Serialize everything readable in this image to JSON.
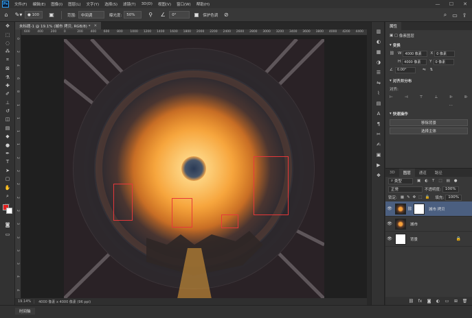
{
  "menubar": {
    "logo": "Ps",
    "items": [
      "文件(F)",
      "编辑(E)",
      "图像(I)",
      "图层(L)",
      "文字(Y)",
      "选择(S)",
      "滤镜(T)",
      "3D(D)",
      "视图(V)",
      "窗口(W)",
      "帮助(H)"
    ],
    "window_controls": [
      "—",
      "☐",
      "✕"
    ]
  },
  "options_bar": {
    "brush_size": "100",
    "range_label": "范围:",
    "range_value": "中间调",
    "exposure_label": "曝光度:",
    "exposure_value": "50%",
    "angle_value": "0°",
    "protect_tones_label": "保护色调"
  },
  "document": {
    "tab_title": "未标题-1 @ 19.1% (城市 拷贝, RGB/8) *",
    "zoom": "19.14%",
    "size_info": "4000 像素 x 4000 像素 (96 ppi)"
  },
  "ruler": {
    "h_labels": [
      "600",
      "400",
      "200",
      "0",
      "200",
      "400",
      "600",
      "800",
      "1000",
      "1200",
      "1400",
      "1600",
      "1800",
      "2000",
      "2200",
      "2400",
      "2600",
      "2800",
      "3000",
      "3200",
      "3400",
      "3600",
      "3800",
      "4000",
      "4200",
      "4400",
      "4600"
    ],
    "v_labels": [
      "0",
      "2",
      "4",
      "6",
      "8",
      "1",
      "1",
      "1",
      "1",
      "2",
      "2",
      "2",
      "2",
      "2",
      "3",
      "3",
      "3",
      "3",
      "4",
      "4"
    ]
  },
  "properties": {
    "tabs": [
      "属性"
    ],
    "layer_kind": "像素图层",
    "transform_label": "变换",
    "w_label": "W",
    "w_value": "4000 像素",
    "h_label": "H",
    "h_value": "4000 像素",
    "x_label": "X",
    "x_value": "0 像素",
    "y_label": "Y",
    "y_value": "0 像素",
    "angle_value": "0.00°",
    "align_label": "对齐并分布",
    "align_sub": "对齐:",
    "quick_actions_label": "快速操作",
    "remove_bg_button": "移除背景",
    "select_subject_button": "选择主体"
  },
  "layers_panel": {
    "tabs": [
      "3D",
      "图层",
      "通道",
      "路径"
    ],
    "filter_kind": "类型",
    "blend_mode": "正常",
    "opacity_label": "不透明度:",
    "opacity_value": "100%",
    "lock_label": "锁定:",
    "fill_label": "填充:",
    "fill_value": "100%",
    "layers": [
      {
        "name": "城市 拷贝",
        "selected": true
      },
      {
        "name": "城市",
        "selected": false
      },
      {
        "name": "背景",
        "selected": false
      }
    ]
  },
  "timeline": {
    "label": "时间轴"
  },
  "colors": {
    "foreground": "#e02020",
    "background": "#ffffff",
    "selection_box": "#e8383a",
    "layer_selected": "#4b5f80"
  }
}
